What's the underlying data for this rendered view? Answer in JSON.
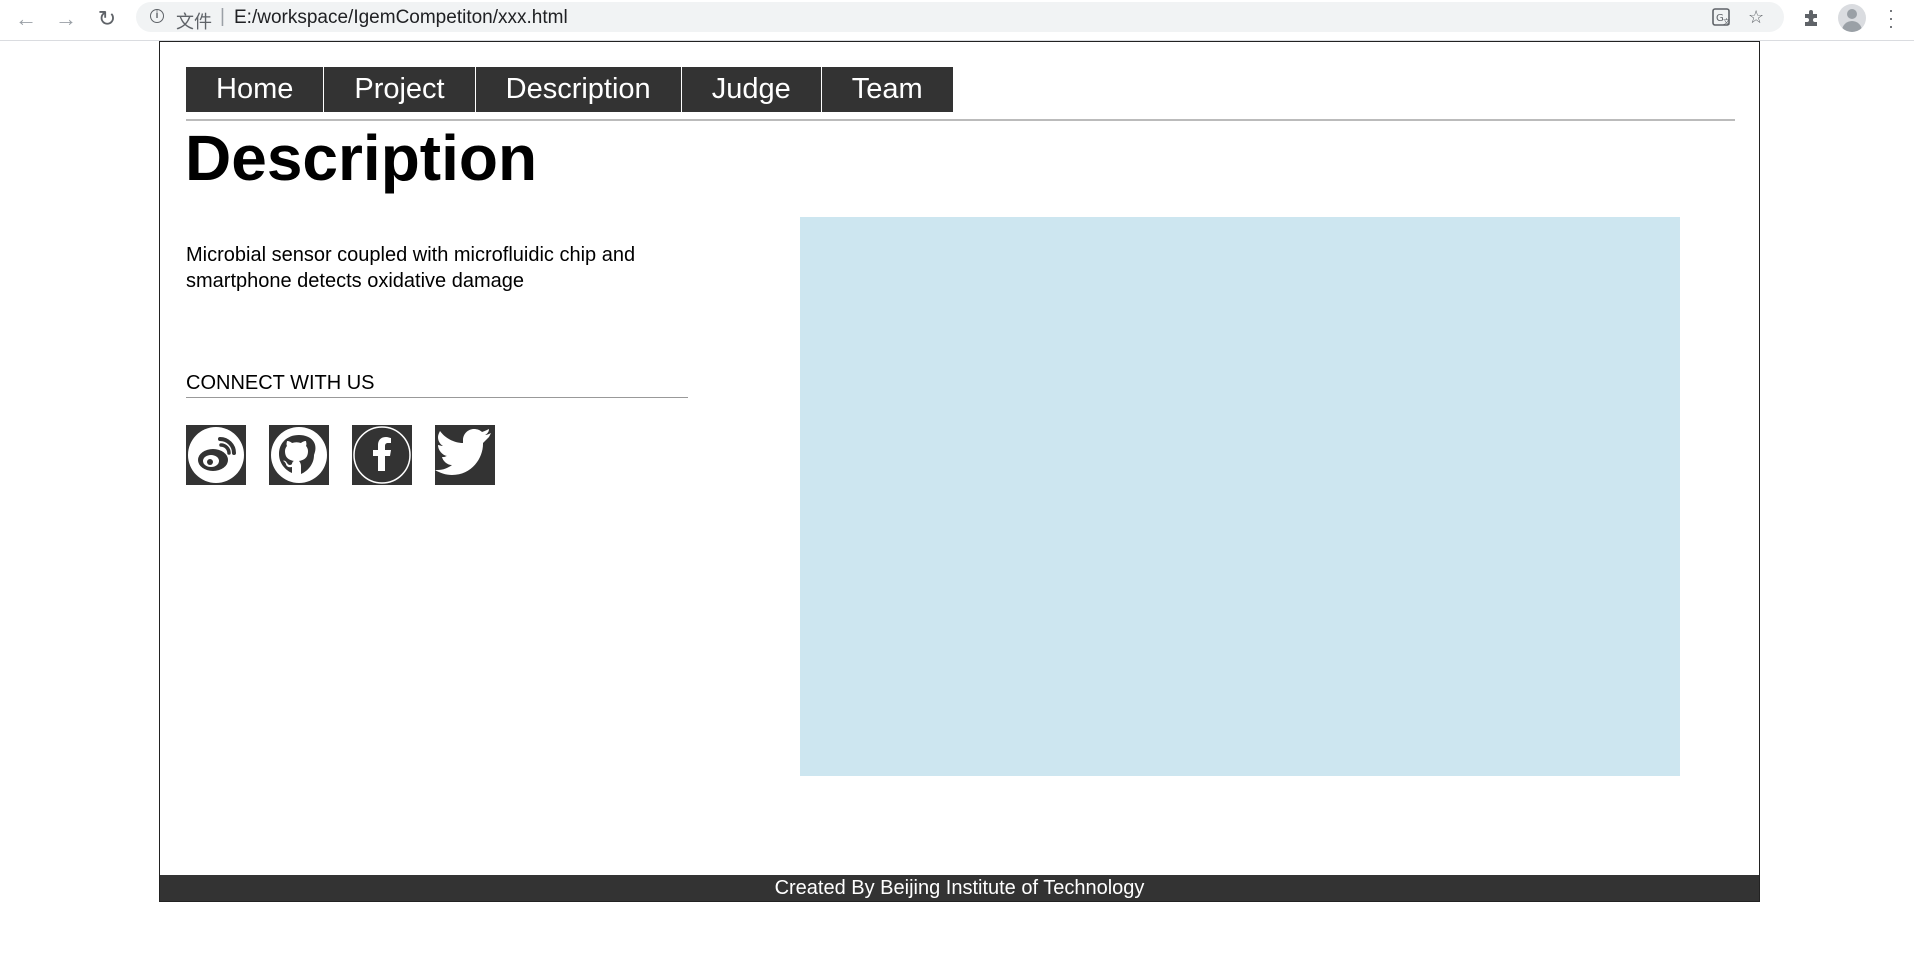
{
  "browser": {
    "scheme_label": "文件",
    "separator": "|",
    "url": "E:/workspace/IgemCompetiton/xxx.html",
    "info_icon": "info-icon",
    "icons": [
      "back-arrow-icon",
      "forward-arrow-icon",
      "reload-icon",
      "translate-icon",
      "star-icon",
      "extensions-icon",
      "profile-avatar-icon",
      "menu-dots-icon"
    ]
  },
  "nav": {
    "items": [
      {
        "label": "Home"
      },
      {
        "label": "Project"
      },
      {
        "label": "Description"
      },
      {
        "label": "Judge"
      },
      {
        "label": "Team"
      }
    ]
  },
  "main": {
    "title": "Description",
    "description": "Microbial sensor coupled with microfluidic chip and smartphone detects oxidative damage",
    "connect_heading": "CONNECT WITH US",
    "socials": [
      "weibo-icon",
      "github-icon",
      "facebook-icon",
      "twitter-icon"
    ],
    "image_placeholder_color": "#cde6f0"
  },
  "footer": {
    "text": "Created By Beijing Institute of Technology"
  },
  "colors": {
    "nav_bg": "#333333",
    "footer_bg": "#333333",
    "text": "#000000"
  }
}
